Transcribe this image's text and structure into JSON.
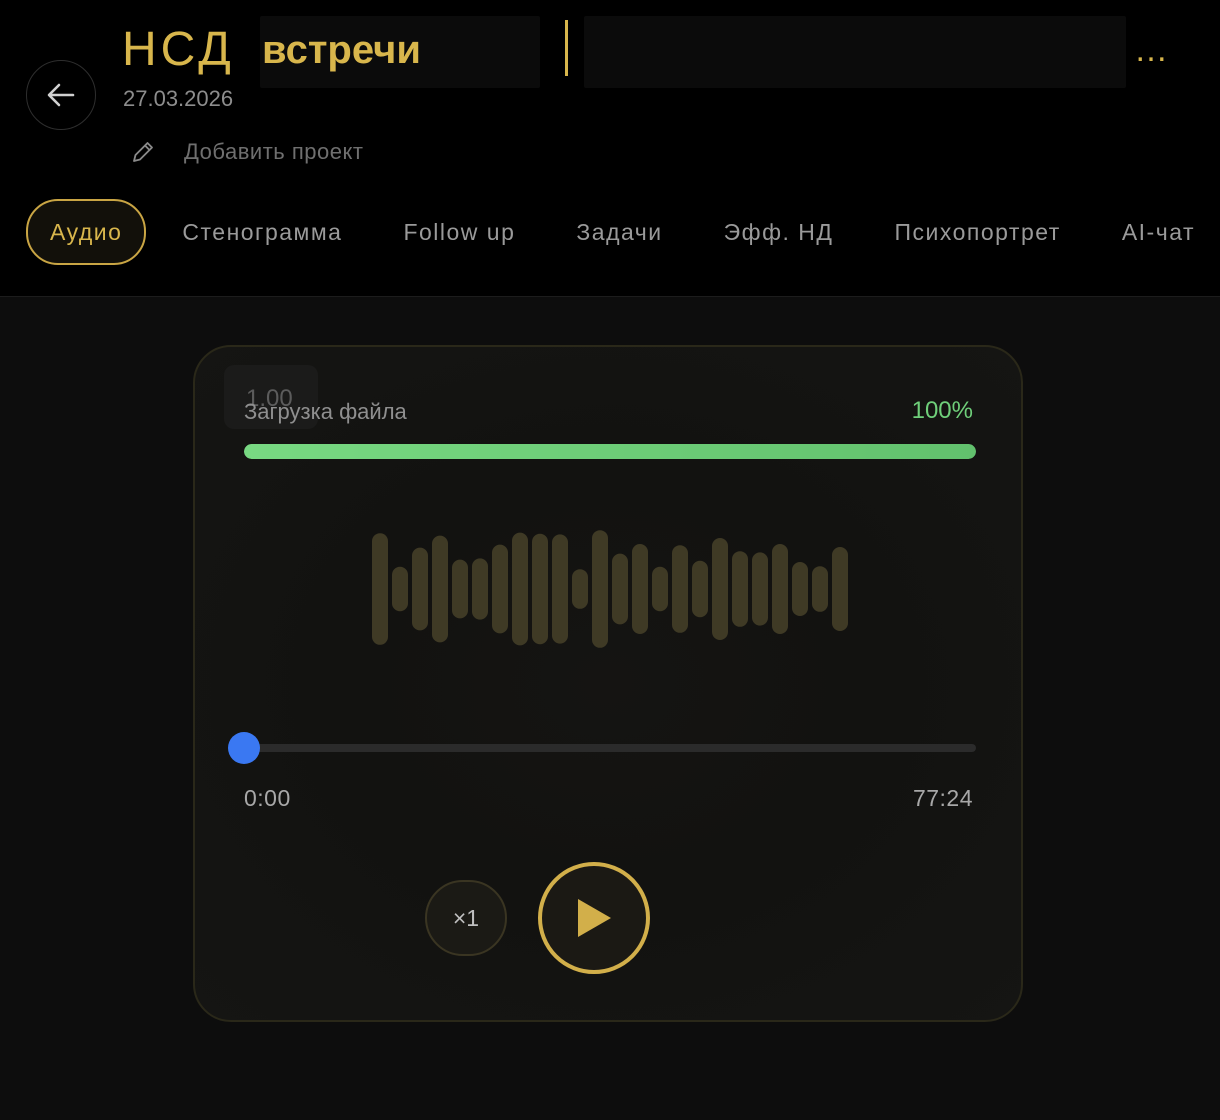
{
  "header": {
    "title_prefix": "НСД",
    "title_word": "встречи",
    "title_ellipsis": "…",
    "date": "27.03.2026",
    "add_project_label": "Добавить проект"
  },
  "tabs": [
    {
      "label": "Аудио",
      "active": true
    },
    {
      "label": "Стенограмма",
      "active": false
    },
    {
      "label": "Follow up",
      "active": false
    },
    {
      "label": "Задачи",
      "active": false
    },
    {
      "label": "Эфф. НД",
      "active": false
    },
    {
      "label": "Психопортрет",
      "active": false
    },
    {
      "label": "AI-чат",
      "active": false
    }
  ],
  "player": {
    "speed_ghost": "1.00",
    "upload_label": "Загрузка файла",
    "upload_percent_text": "100%",
    "upload_fraction": 1.0,
    "waveform_levels": [
      0.93,
      0.37,
      0.69,
      0.89,
      0.49,
      0.51,
      0.74,
      0.94,
      0.92,
      0.91,
      0.33,
      0.98,
      0.59,
      0.75,
      0.37,
      0.73,
      0.47,
      0.85,
      0.63,
      0.61,
      0.75,
      0.45,
      0.38,
      0.7
    ],
    "playback_fraction": 0.0,
    "time_current": "0:00",
    "time_total": "77:24",
    "speed_label": "×1"
  },
  "colors": {
    "accent_gold": "#d8b64c",
    "progress_green": "#6fcf7a",
    "seek_thumb_blue": "#3a78f2",
    "waveform_bar": "#3f3a25"
  }
}
